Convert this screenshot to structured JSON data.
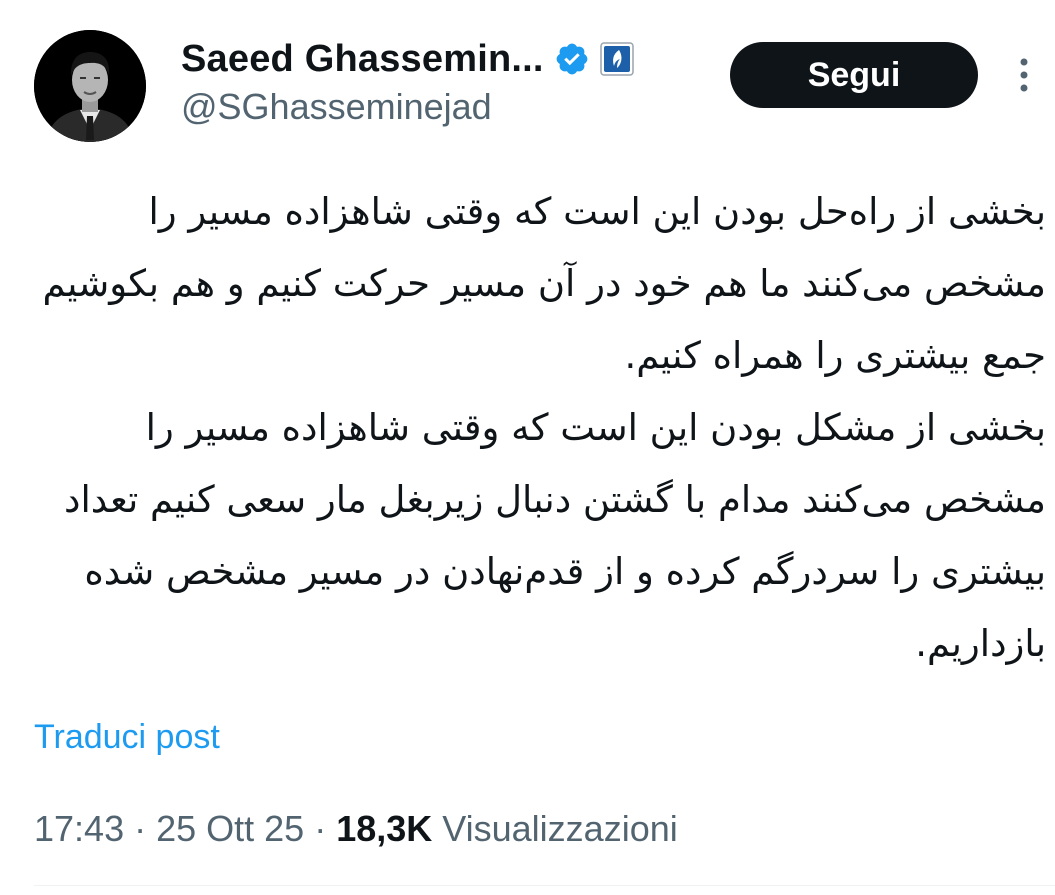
{
  "author": {
    "display_name": "Saeed Ghassemin...",
    "handle": "@SGhasseminejad",
    "verified_icon": "verified-badge-icon",
    "affiliate_icon": "affiliate-badge-icon",
    "brand_color": "#1d9bf0"
  },
  "actions": {
    "follow_label": "Segui",
    "more_icon": "more-vertical-icon"
  },
  "tweet": {
    "paragraphs": [
      "بخشی از راه‌حل بودن این است که وقتی شاهزاده مسیر را مشخص می‌کنند ما هم خود در آن مسیر حرکت کنیم و هم بکوشیم جمع بیشتری را همراه کنیم.",
      "بخشی از مشکل بودن این است که وقتی شاهزاده مسیر را مشخص می‌کنند مدام با گشتن دنبال زیربغل مار سعی کنیم تعداد بیشتری را سردرگم  کرده و از قدم‌نهادن در مسیر مشخص شده بازداریم."
    ],
    "translate_label": "Traduci post"
  },
  "meta": {
    "time": "17:43",
    "separator": " · ",
    "date": "25 Ott 25",
    "views_count": "18,3K",
    "views_label": " Visualizzazioni"
  }
}
